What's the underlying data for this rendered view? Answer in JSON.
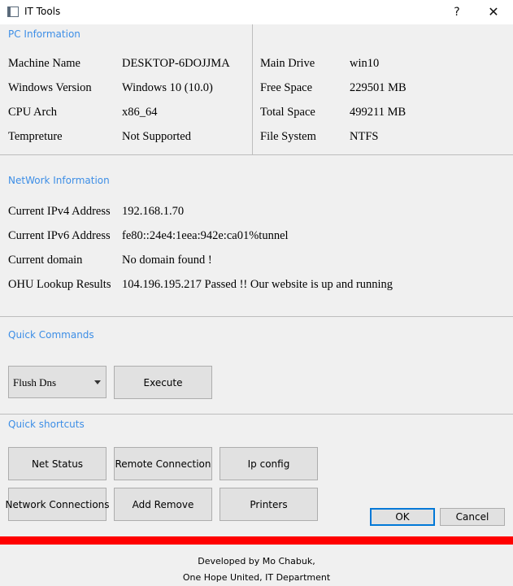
{
  "window": {
    "title": "IT Tools",
    "help_label": "?",
    "close_label": "✕"
  },
  "pc_info": {
    "title": "PC Information",
    "left": [
      {
        "label": "Machine Name",
        "value": "DESKTOP-6DOJJMA"
      },
      {
        "label": "Windows Version",
        "value": "Windows 10 (10.0)"
      },
      {
        "label": "CPU Arch",
        "value": "x86_64"
      },
      {
        "label": "Tempreture",
        "value": "Not Supported"
      }
    ],
    "right": [
      {
        "label": "Main Drive",
        "value": "win10"
      },
      {
        "label": "Free Space",
        "value": "229501 MB"
      },
      {
        "label": "Total Space",
        "value": "499211 MB"
      },
      {
        "label": "File System",
        "value": "NTFS"
      }
    ]
  },
  "network_info": {
    "title": "NetWork Information",
    "rows": [
      {
        "label": "Current IPv4 Address",
        "value": "192.168.1.70"
      },
      {
        "label": "Current IPv6 Address",
        "value": "fe80::24e4:1eea:942e:ca01%tunnel"
      },
      {
        "label": "Current domain",
        "value": "No domain found !"
      },
      {
        "label": "OHU Lookup Results",
        "value": "104.196.195.217  Passed !! Our website is up and running"
      }
    ]
  },
  "quick_commands": {
    "title": "Quick Commands",
    "selected_command": "Flush Dns",
    "execute_label": "Execute"
  },
  "quick_shortcuts": {
    "title": "Quick shortcuts",
    "buttons": [
      "Net Status",
      "Remote Connection",
      "Ip config",
      "Network Connections",
      "Add Remove",
      "Printers"
    ]
  },
  "dialog": {
    "ok_label": "OK",
    "cancel_label": "Cancel"
  },
  "footer": {
    "line1": "Developed by Mo Chabuk,",
    "line2": "One Hope United, IT Department"
  },
  "colors": {
    "accent": "#3d8ee6",
    "danger_bar": "#ff0000",
    "default_button_border": "#0078d7"
  }
}
